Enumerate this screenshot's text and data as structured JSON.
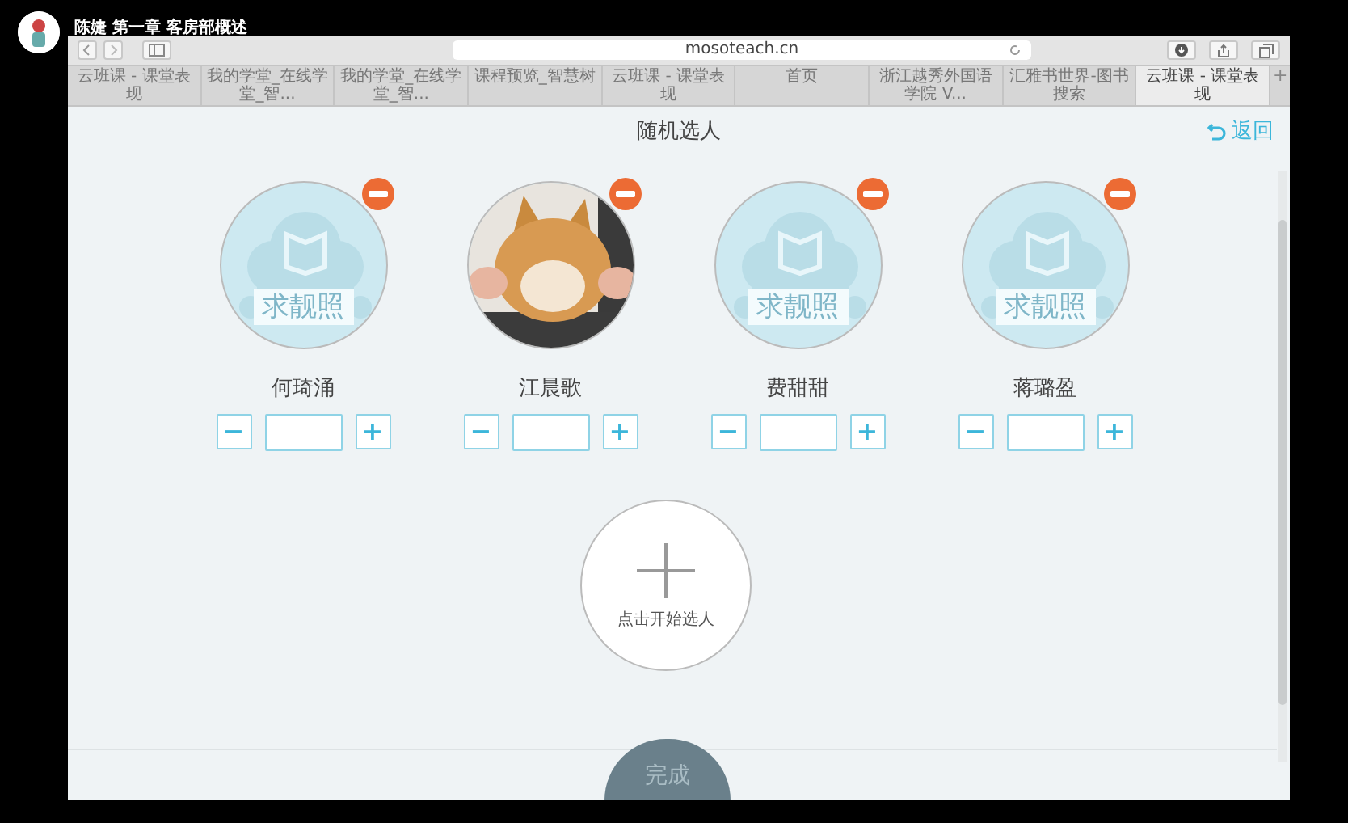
{
  "window": {
    "caption": "陈婕 第一章 客房部概述"
  },
  "browser": {
    "url": "mosoteach.cn",
    "tabs": [
      {
        "label": "云班课 - 课堂表现",
        "selected": false
      },
      {
        "label": "我的学堂_在线学堂_智...",
        "selected": false
      },
      {
        "label": "我的学堂_在线学堂_智...",
        "selected": false
      },
      {
        "label": "课程预览_智慧树",
        "selected": false
      },
      {
        "label": "云班课 - 课堂表现",
        "selected": false
      },
      {
        "label": "首页",
        "selected": false
      },
      {
        "label": "浙江越秀外国语学院 V...",
        "selected": false
      },
      {
        "label": "汇雅书世界-图书搜索",
        "selected": false
      },
      {
        "label": "云班课 - 课堂表现",
        "selected": true
      }
    ],
    "new_tab": "+"
  },
  "page": {
    "title": "随机选人",
    "back": "返回"
  },
  "students": [
    {
      "name": "何琦涌",
      "avatar": {
        "kind": "placeholder",
        "text": "求靓照"
      },
      "minus": "−",
      "plus": "+"
    },
    {
      "name": "江晨歌",
      "minus": "−",
      "plus": "+"
    },
    {
      "name": "费甜甜",
      "avatar": {
        "kind": "placeholder",
        "text": "求靓照"
      },
      "minus": "−",
      "plus": "+"
    },
    {
      "name": "蒋璐盈",
      "avatar": {
        "kind": "placeholder",
        "text": "求靓照"
      },
      "minus": "−",
      "plus": "+"
    }
  ],
  "start": {
    "label": "点击开始选人"
  },
  "done": "完成"
}
